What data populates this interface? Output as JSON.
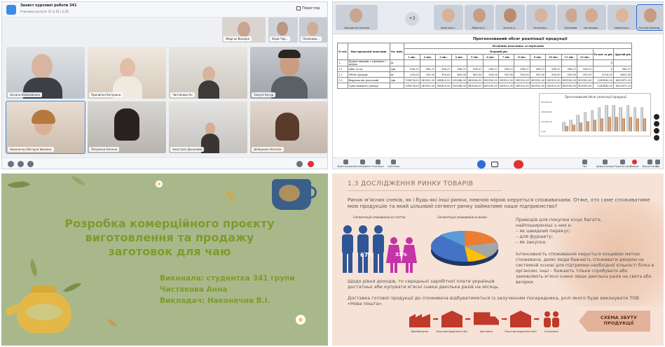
{
  "meeting": {
    "title": "Захист курсової роботи 341",
    "subtitle": "Учасники зустрічі: 11 зі 22 | 1:16",
    "view_label": "Перегляд",
    "participants": [
      {
        "name": "Оксана Комісаренко"
      },
      {
        "name": "Прилипко Катерина"
      },
      {
        "name": "Чистякова Ан"
      },
      {
        "name": "Зозуля Артур"
      },
      {
        "name": "Наконечна Вікторія Іванівна"
      },
      {
        "name": "Петренко Євгенія"
      },
      {
        "name": "Анастасія Денисова"
      },
      {
        "name": "Шлеценко Наталія"
      }
    ],
    "top_participants": [
      "Жаргал Валерія",
      "Юрій Чер...",
      "Полякова..."
    ]
  },
  "share": {
    "thumb_overflow": "+3",
    "thumbs": [
      "Шлеценко Наталія",
      "Анастасія...",
      "Жаргал Е...",
      "Зозуля А...",
      "Петренко...",
      "Полякова...",
      "Чистякова...",
      "Наконечна...",
      "Оксана Комісар..."
    ],
    "sheet_title": "Прогнозований обсяг реалізації продукції",
    "header_top": "Величина показника за періодами",
    "header_year": "Перший рік",
    "col_no": "№ п/п",
    "col_name": "Вид продукції показник",
    "col_unit": "Од. вим.",
    "col_total": "Разом за рік",
    "col_second": "Другий рік",
    "months": [
      "1 міс.",
      "2 міс.",
      "3 міс.",
      "4 міс.",
      "5 міс.",
      "6 міс.",
      "7 міс.",
      "8 міс.",
      "9 міс.",
      "10 міс.",
      "11 міс.",
      "12 міс."
    ],
    "rows": [
      {
        "no": "1.",
        "name": "Курячі джерки з гірчицею і медом",
        "unit": "кг",
        "vals": [
          "",
          "",
          "",
          "",
          "",
          "",
          "",
          "",
          "",
          "",
          "",
          ""
        ],
        "total": "X",
        "second": ""
      },
      {
        "no": "1.1",
        "name": "Ціна за од.",
        "unit": "грн",
        "vals": [
          "998,37",
          "998,37",
          "998,37",
          "998,37",
          "998,37",
          "998,37",
          "998,37",
          "998,37",
          "998,37",
          "998,37",
          "998,37",
          "998,37"
        ],
        "total": "X",
        "second": "998,37"
      },
      {
        "no": "1.2",
        "name": "Обсяг продаж",
        "unit": "кг",
        "vals": [
          "200,00",
          "250,00",
          "350,00",
          "400,00",
          "450,00",
          "500,00",
          "550,00",
          "550,00",
          "500,00",
          "550,00",
          "500,00",
          "500,00"
        ],
        "total": "5250,00",
        "second": "6825,00"
      },
      {
        "no": "1.3",
        "name": "Виручка від реалізації",
        "unit": "грн",
        "vals": [
          "199674,00",
          "249592,50",
          "349429,50",
          "399348,00",
          "449266,50",
          "499185,00",
          "549103,50",
          "549103,50",
          "499185,00",
          "549103,50",
          "499185,00",
          "499185,00"
        ],
        "total": "5241442,50",
        "second": "6813875,25"
      },
      {
        "no": "",
        "name": "Сума валового доходу:",
        "unit": "",
        "vals": [
          "199674,00",
          "249592,50",
          "349429,50",
          "399348,00",
          "449266,50",
          "499185,00",
          "549103,50",
          "549103,50",
          "499185,00",
          "549103,50",
          "499185,00",
          "499185,00"
        ],
        "total": "5241442,50",
        "second": "6813875,25"
      }
    ],
    "bottom_left": [
      "Пристосувати",
      "Оптимізувати",
      "Учасники",
      "Субтитри"
    ],
    "bottom_right": [
      "Чат",
      "Демонстрація",
      "Підняти руку",
      "Реакції",
      "Відпустити",
      "Ще"
    ]
  },
  "chart_data": {
    "type": "bar",
    "title": "Прогнозований обсяг реалізації продукції",
    "categories": [
      "1 міс.",
      "2 міс.",
      "3 міс.",
      "4 міс.",
      "5 міс.",
      "6 міс.",
      "7 міс.",
      "8 міс.",
      "9 міс.",
      "10 міс.",
      "11 міс.",
      "12 міс."
    ],
    "series": [
      {
        "values": [
          200,
          250,
          350,
          400,
          450,
          500,
          550,
          550,
          500,
          550,
          500,
          500
        ]
      },
      {
        "values": [
          199674,
          249592.5,
          349429.5,
          399348,
          449266.5,
          499185,
          549103.5,
          549103.5,
          499185,
          549103.5,
          499185,
          499185
        ]
      }
    ],
    "ytick_labels": [
      "600000,00",
      "400000,00",
      "200000,00",
      "0,00"
    ],
    "ylim": [
      0,
      600000
    ]
  },
  "slide1": {
    "title_l1": "Розробка комерційного проєкту",
    "title_l2": "виготовлення та продажу",
    "title_l3": "заготовок для чаю",
    "author_l1": "Виконала: студентка 341 групи",
    "author_l2": "Чистякова Анна",
    "author_l3": "Викладач: Наконечна В.І."
  },
  "slide2": {
    "heading": "1.3 ДОСЛІДЖЕННЯ РИНКУ ТОВАРІВ",
    "intro": "Ринок м’ясних снеків, як і будь-які інші ринки, певною мірою керується споживачами. Отже, хто саме споживатиме мою продукцію та який цільовий сегмент ринку займатиме наше підприємство?",
    "seg_gender": "Сегментація споживачів за статтю:",
    "seg_age": "Сегментація споживачів за віком:",
    "pct_men": "67%",
    "pct_women": "33%",
    "reasons_title": "Приводів для покупки існує багато,",
    "reasons_sub": "найпоширеніші з них є:",
    "reasons": [
      "як швидкий перекус;",
      "для фуршету;",
      "як закуска."
    ],
    "intensity": "Інтенсивність споживання керується кінцевою метою споживача, деякі люди бажають споживати джерки на системній основі для підтримки необхідної кількості білка в організмі, інші – бажають тільки спробувати або замовляють м’ясні снеки лише декілька разів на свята або вечірки.",
    "income": "Щодо рівня доходів, то середньої заробітної плати українців достатньо аби купувати м’ясні снеки декілька разів на місяць.",
    "delivery": "Доставка готової продукції до споживача відбуватиметься із залученням посередника, ролі якого буде виконувати ТОВ «Нова пошта».",
    "schema_l1": "СХЕМА ЗБУТУ",
    "schema_l2": "ПРОДУКЦІЇ",
    "flow": [
      "Виробництво",
      "Поштове відділення №1",
      "Доставка",
      "Поштове відділення №2",
      "Споживачі"
    ]
  },
  "colors": {
    "slide_green": "#7d9b2c",
    "slide_bg": "#a9b88a",
    "peach_bg": "#f6e2d6",
    "accent_blue": "#2b6cd8",
    "hangup_red": "#e03131"
  }
}
